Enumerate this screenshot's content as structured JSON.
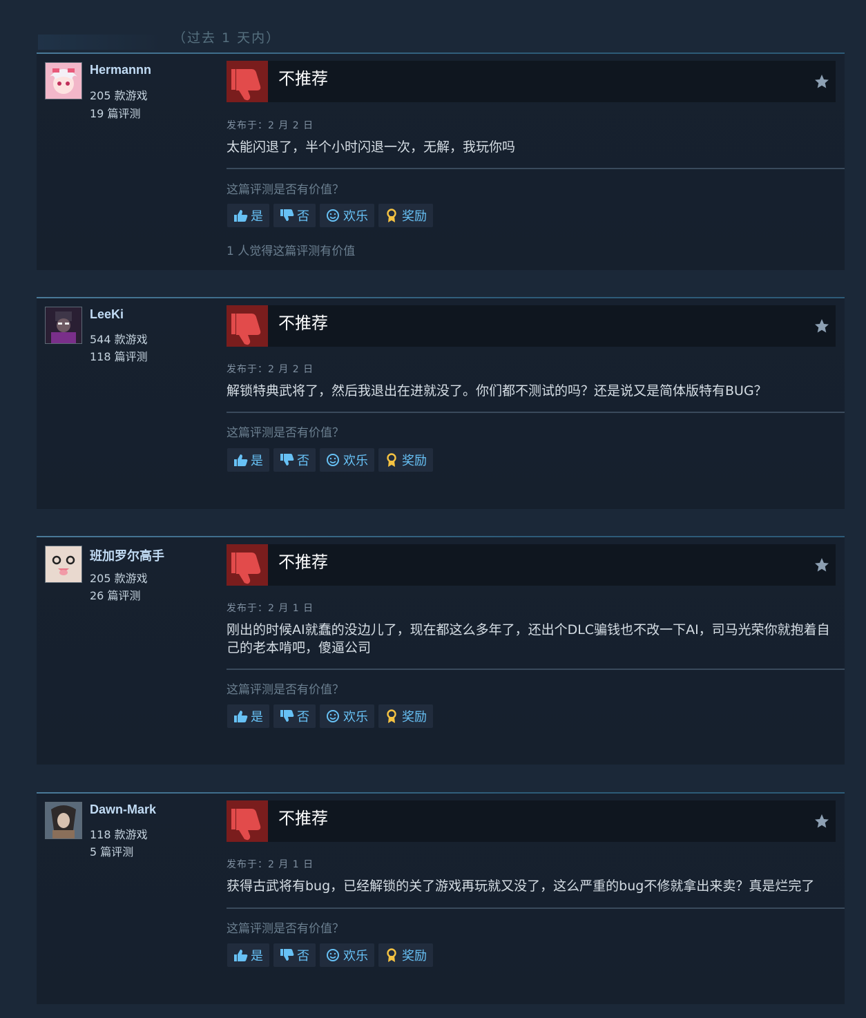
{
  "header": {
    "period_label": "（过去 1 天内）"
  },
  "reviews": [
    {
      "username": "Hermannn",
      "games": "205 款游戏",
      "reviews": "19 篇评测",
      "verdict": "不推荐",
      "posted": "发布于：2 月 2 日",
      "content": "太能闪退了，半个小时闪退一次，无解，我玩你吗",
      "helpful_question": "这篇评测是否有价值？",
      "vote_yes": "是",
      "vote_no": "否",
      "vote_funny": "欢乐",
      "vote_award": "奖励",
      "helpful_count": "1 人觉得这篇评测有价值"
    },
    {
      "username": "LeeKi",
      "games": "544 款游戏",
      "reviews": "118 篇评测",
      "verdict": "不推荐",
      "posted": "发布于：2 月 2 日",
      "content": "解锁特典武将了，然后我退出在进就没了。你们都不测试的吗？还是说又是简体版特有BUG？",
      "helpful_question": "这篇评测是否有价值？",
      "vote_yes": "是",
      "vote_no": "否",
      "vote_funny": "欢乐",
      "vote_award": "奖励"
    },
    {
      "username": "班加罗尔高手",
      "games": "205 款游戏",
      "reviews": "26 篇评测",
      "verdict": "不推荐",
      "posted": "发布于：2 月 1 日",
      "content": "刚出的时候AI就蠢的没边儿了，现在都这么多年了，还出个DLC骗钱也不改一下AI，司马光荣你就抱着自己的老本啃吧，傻逼公司",
      "helpful_question": "这篇评测是否有价值？",
      "vote_yes": "是",
      "vote_no": "否",
      "vote_funny": "欢乐",
      "vote_award": "奖励"
    },
    {
      "username": "Dawn-Mark",
      "games": "118 款游戏",
      "reviews": "5 篇评测",
      "verdict": "不推荐",
      "posted": "发布于：2 月 1 日",
      "content": "获得古武将有bug，已经解锁的关了游戏再玩就又没了，这么严重的bug不修就拿出来卖？真是烂完了",
      "helpful_question": "这篇评测是否有价值？",
      "vote_yes": "是",
      "vote_no": "否",
      "vote_funny": "欢乐",
      "vote_award": "奖励"
    }
  ],
  "colors": {
    "background": "#1b2838",
    "panel": "#16202d",
    "verdict_icon_bg": "#7a1d1d",
    "thumb_down": "#e24b4b",
    "link_blue": "#67c1f5",
    "award_gold": "#f5c342"
  },
  "icons": {
    "verdict": "thumbs-down-icon",
    "favorite": "star-icon",
    "yes": "thumbs-up-icon",
    "no": "thumbs-down-icon",
    "funny": "smiley-icon",
    "award": "award-ribbon-icon"
  }
}
